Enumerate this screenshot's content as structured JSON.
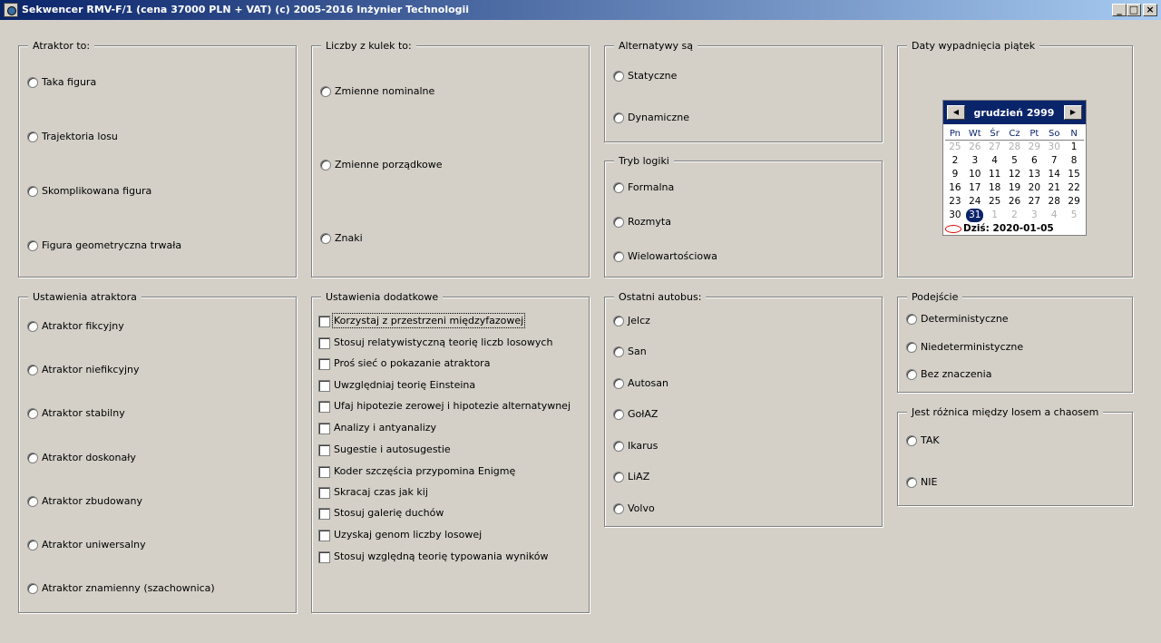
{
  "window": {
    "title": "Sekwencer RMV-F/1 (cena 37000 PLN + VAT) (c) 2005-2016 Inżynier Technologii",
    "min_label": "_",
    "max_label": "□",
    "close_label": "×"
  },
  "atraktor": {
    "legend": "Atraktor to:",
    "options": [
      "Taka figura",
      "Trajektoria losu",
      "Skomplikowana figura",
      "Figura geometryczna trwała"
    ]
  },
  "liczby": {
    "legend": "Liczby z kulek to:",
    "options": [
      "Zmienne nominalne",
      "Zmienne porządkowe",
      "Znaki"
    ]
  },
  "alternatywy": {
    "legend": "Alternatywy są",
    "options": [
      "Statyczne",
      "Dynamiczne"
    ]
  },
  "tryb": {
    "legend": "Tryb logiki",
    "options": [
      "Formalna",
      "Rozmyta",
      "Wielowartościowa"
    ]
  },
  "daty": {
    "legend": "Daty wypadnięcia piątek",
    "calendar": {
      "month_label": "grudzień 2999",
      "prev_label": "◀",
      "next_label": "▶",
      "weekdays": [
        "Pn",
        "Wt",
        "Śr",
        "Cz",
        "Pt",
        "So",
        "N"
      ],
      "weeks": [
        [
          "25",
          "26",
          "27",
          "28",
          "29",
          "30",
          "1"
        ],
        [
          "2",
          "3",
          "4",
          "5",
          "6",
          "7",
          "8"
        ],
        [
          "9",
          "10",
          "11",
          "12",
          "13",
          "14",
          "15"
        ],
        [
          "16",
          "17",
          "18",
          "19",
          "20",
          "21",
          "22"
        ],
        [
          "23",
          "24",
          "25",
          "26",
          "27",
          "28",
          "29"
        ],
        [
          "30",
          "31",
          "1",
          "2",
          "3",
          "4",
          "5"
        ]
      ],
      "selected_day": "31",
      "today_label": "Dziś: 2020-01-05"
    }
  },
  "ustawienia_atraktora": {
    "legend": "Ustawienia atraktora",
    "options": [
      "Atraktor fikcyjny",
      "Atraktor niefikcyjny",
      "Atraktor stabilny",
      "Atraktor doskonały",
      "Atraktor zbudowany",
      "Atraktor uniwersalny",
      "Atraktor znamienny (szachownica)"
    ]
  },
  "ustawienia_dodatkowe": {
    "legend": "Ustawienia dodatkowe",
    "options": [
      "Korzystaj z przestrzeni międzyfazowej",
      "Stosuj relatywistyczną teorię liczb losowych",
      "Proś sieć o pokazanie atraktora",
      "Uwzględniaj teorię Einsteina",
      "Ufaj hipotezie zerowej i hipotezie alternatywnej",
      "Analizy i antyanalizy",
      "Sugestie i autosugestie",
      "Koder szczęścia przypomina Enigmę",
      "Skracaj czas jak kij",
      "Stosuj galerię duchów",
      "Uzyskaj genom liczby losowej",
      "Stosuj względną teorię typowania wyników"
    ]
  },
  "autobus": {
    "legend": "Ostatni autobus:",
    "options": [
      "Jelcz",
      "San",
      "Autosan",
      "GołAZ",
      "Ikarus",
      "LiAZ",
      "Volvo"
    ]
  },
  "podejscie": {
    "legend": "Podejście",
    "options": [
      "Deterministyczne",
      "Niedeterministyczne",
      "Bez znaczenia"
    ]
  },
  "roznica": {
    "legend": "Jest różnica między losem a chaosem",
    "options": [
      "TAK",
      "NIE"
    ]
  }
}
